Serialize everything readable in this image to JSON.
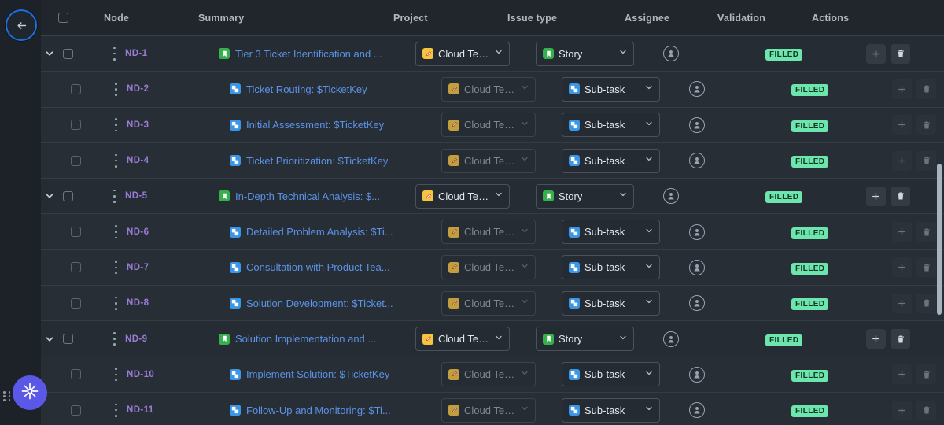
{
  "nav": {
    "back_label": "Back",
    "back_icon": "arrow-left-icon"
  },
  "table": {
    "columns": [
      {
        "key": "node",
        "label": "Node"
      },
      {
        "key": "summary",
        "label": "Summary"
      },
      {
        "key": "project",
        "label": "Project"
      },
      {
        "key": "issue_type",
        "label": "Issue type"
      },
      {
        "key": "assignee",
        "label": "Assignee"
      },
      {
        "key": "validation",
        "label": "Validation"
      },
      {
        "key": "actions",
        "label": "Actions"
      }
    ],
    "select_all_checkbox": "unchecked",
    "rows": [
      {
        "id": "ND-1",
        "level": "parent",
        "expanded": true,
        "summary": "Tier 3 Ticket Identification and ...",
        "summary_icon": "story-icon",
        "project": "Cloud Team (",
        "project_icon": "project-avatar-icon",
        "issue_type": "Story",
        "issue_type_icon": "story-icon",
        "assignee": "",
        "assignee_icon": "user-avatar-icon",
        "validation": "FILLED",
        "actions": [
          "add-icon",
          "delete-icon"
        ]
      },
      {
        "id": "ND-2",
        "level": "child",
        "expanded": null,
        "summary": "Ticket Routing: $TicketKey",
        "summary_icon": "subtask-icon",
        "project": "Cloud Team (",
        "project_icon": "project-avatar-icon",
        "issue_type": "Sub-task",
        "issue_type_icon": "subtask-icon",
        "assignee": "",
        "assignee_icon": "user-avatar-icon",
        "validation": "FILLED",
        "actions": [
          "add-icon",
          "delete-icon"
        ]
      },
      {
        "id": "ND-3",
        "level": "child",
        "expanded": null,
        "summary": "Initial Assessment: $TicketKey",
        "summary_icon": "subtask-icon",
        "project": "Cloud Team (",
        "project_icon": "project-avatar-icon",
        "issue_type": "Sub-task",
        "issue_type_icon": "subtask-icon",
        "assignee": "",
        "assignee_icon": "user-avatar-icon",
        "validation": "FILLED",
        "actions": [
          "add-icon",
          "delete-icon"
        ]
      },
      {
        "id": "ND-4",
        "level": "child",
        "expanded": null,
        "summary": "Ticket Prioritization: $TicketKey",
        "summary_icon": "subtask-icon",
        "project": "Cloud Team (",
        "project_icon": "project-avatar-icon",
        "issue_type": "Sub-task",
        "issue_type_icon": "subtask-icon",
        "assignee": "",
        "assignee_icon": "user-avatar-icon",
        "validation": "FILLED",
        "actions": [
          "add-icon",
          "delete-icon"
        ]
      },
      {
        "id": "ND-5",
        "level": "parent",
        "expanded": true,
        "summary": "In-Depth Technical Analysis: $...",
        "summary_icon": "story-icon",
        "project": "Cloud Team (",
        "project_icon": "project-avatar-icon",
        "issue_type": "Story",
        "issue_type_icon": "story-icon",
        "assignee": "",
        "assignee_icon": "user-avatar-icon",
        "validation": "FILLED",
        "actions": [
          "add-icon",
          "delete-icon"
        ]
      },
      {
        "id": "ND-6",
        "level": "child",
        "expanded": null,
        "summary": "Detailed Problem Analysis: $Ti...",
        "summary_icon": "subtask-icon",
        "project": "Cloud Team (",
        "project_icon": "project-avatar-icon",
        "issue_type": "Sub-task",
        "issue_type_icon": "subtask-icon",
        "assignee": "",
        "assignee_icon": "user-avatar-icon",
        "validation": "FILLED",
        "actions": [
          "add-icon",
          "delete-icon"
        ]
      },
      {
        "id": "ND-7",
        "level": "child",
        "expanded": null,
        "summary": "Consultation with Product Tea...",
        "summary_icon": "subtask-icon",
        "project": "Cloud Team (",
        "project_icon": "project-avatar-icon",
        "issue_type": "Sub-task",
        "issue_type_icon": "subtask-icon",
        "assignee": "",
        "assignee_icon": "user-avatar-icon",
        "validation": "FILLED",
        "actions": [
          "add-icon",
          "delete-icon"
        ]
      },
      {
        "id": "ND-8",
        "level": "child",
        "expanded": null,
        "summary": "Solution Development: $Ticket...",
        "summary_icon": "subtask-icon",
        "project": "Cloud Team (",
        "project_icon": "project-avatar-icon",
        "issue_type": "Sub-task",
        "issue_type_icon": "subtask-icon",
        "assignee": "",
        "assignee_icon": "user-avatar-icon",
        "validation": "FILLED",
        "actions": [
          "add-icon",
          "delete-icon"
        ]
      },
      {
        "id": "ND-9",
        "level": "parent",
        "expanded": true,
        "summary": "Solution Implementation and ...",
        "summary_icon": "story-icon",
        "project": "Cloud Team (",
        "project_icon": "project-avatar-icon",
        "issue_type": "Story",
        "issue_type_icon": "story-icon",
        "assignee": "",
        "assignee_icon": "user-avatar-icon",
        "validation": "FILLED",
        "actions": [
          "add-icon",
          "delete-icon"
        ]
      },
      {
        "id": "ND-10",
        "level": "child",
        "expanded": null,
        "summary": "Implement Solution: $TicketKey",
        "summary_icon": "subtask-icon",
        "project": "Cloud Team (",
        "project_icon": "project-avatar-icon",
        "issue_type": "Sub-task",
        "issue_type_icon": "subtask-icon",
        "assignee": "",
        "assignee_icon": "user-avatar-icon",
        "validation": "FILLED",
        "actions": [
          "add-icon",
          "delete-icon"
        ]
      },
      {
        "id": "ND-11",
        "level": "child",
        "expanded": null,
        "summary": "Follow-Up and Monitoring: $Ti...",
        "summary_icon": "subtask-icon",
        "project": "Cloud Team (",
        "project_icon": "project-avatar-icon",
        "issue_type": "Sub-task",
        "issue_type_icon": "subtask-icon",
        "assignee": "",
        "assignee_icon": "user-avatar-icon",
        "validation": "FILLED",
        "actions": [
          "add-icon",
          "delete-icon"
        ]
      }
    ]
  },
  "floating_widget": {
    "icon": "sunburst-icon",
    "drag_handle": "drag-grip-icon"
  },
  "colors": {
    "background": "#21262c",
    "row_parent": "#262c33",
    "row_child": "#282e35",
    "accent_blue": "#5b93e8",
    "node_purple": "#9a7bd6",
    "badge_green": "#6de6ad",
    "story_green": "#35b04a",
    "subtask_blue": "#3a97e8",
    "project_yellow": "#f5c542",
    "fab_purple": "#5b58e8",
    "back_border": "#1d6fe0"
  }
}
